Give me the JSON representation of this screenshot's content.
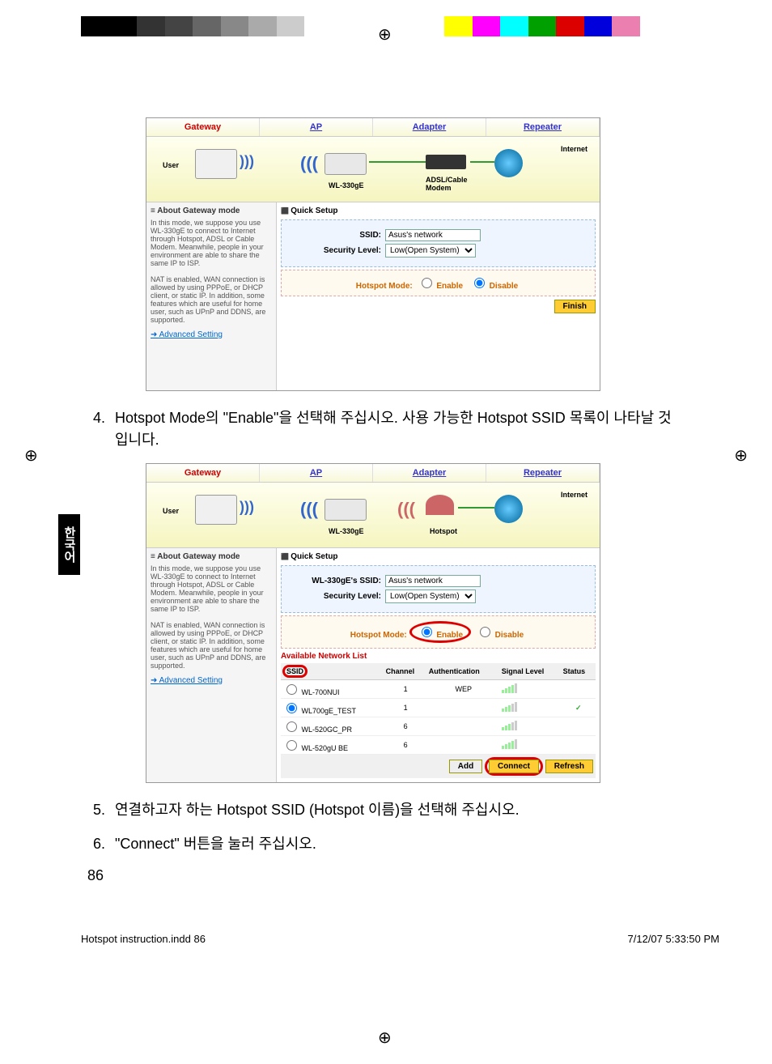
{
  "calibration_colors": [
    "#000",
    "#000",
    "#333",
    "#444",
    "#666",
    "#888",
    "#aaa",
    "#ccc",
    "#fff",
    "#fff",
    "#fff",
    "#fff",
    "#fff",
    "#ff0",
    "#f0f",
    "#0ff",
    "#00a000",
    "#d00",
    "#00d",
    "#ea7fb0",
    "#fff",
    "#fff"
  ],
  "tabs": {
    "gateway": "Gateway",
    "ap": "AP",
    "adapter": "Adapter",
    "repeater": "Repeater"
  },
  "diagram": {
    "user": "User",
    "device": "WL-330gE",
    "modem": "ADSL/Cable\nModem",
    "hotspot": "Hotspot",
    "internet": "Internet"
  },
  "about": {
    "title": "About Gateway mode",
    "p1": "In this mode, we suppose you use WL-330gE to connect to Internet through Hotspot, ADSL or Cable Modem. Meanwhile, people in your environment are able to share the same IP to ISP.",
    "p2": "NAT is enabled, WAN connection is allowed by using PPPoE, or DHCP client, or static IP. In addition, some features which are useful for home user, such as UPnP and DDNS, are supported.",
    "link": "Advanced Setting"
  },
  "setup": {
    "title": "Quick Setup",
    "ssid_label": "SSID:",
    "ssid2_label": "WL-330gE's SSID:",
    "ssid_value": "Asus's network",
    "sec_label": "Security Level:",
    "sec_value": "Low(Open System)",
    "hotspot_label": "Hotspot Mode:",
    "enable": "Enable",
    "disable": "Disable",
    "finish": "Finish"
  },
  "netlist": {
    "title": "Available Network List",
    "headers": {
      "ssid": "SSID",
      "channel": "Channel",
      "auth": "Authentication",
      "signal": "Signal Level",
      "status": "Status"
    },
    "rows": [
      {
        "ssid": "WL-700NUI",
        "channel": "1",
        "auth": "WEP",
        "sig": "s4",
        "status": ""
      },
      {
        "ssid": "WL700gE_TEST",
        "channel": "1",
        "auth": "",
        "sig": "s3",
        "status": "✓"
      },
      {
        "ssid": "WL-520GC_PR",
        "channel": "6",
        "auth": "",
        "sig": "s3",
        "status": ""
      },
      {
        "ssid": "WL-520gU BE",
        "channel": "6",
        "auth": "",
        "sig": "s4",
        "status": ""
      }
    ],
    "add": "Add",
    "connect": "Connect",
    "refresh": "Refresh"
  },
  "steps": {
    "s4": "Hotspot Mode의 \"Enable\"을 선택해 주십시오. 사용 가능한 Hotspot SSID 목록이 나타날 것입니다.",
    "s5": "연결하고자 하는 Hotspot SSID (Hotspot 이름)을 선택해 주십시오.",
    "s6": "\"Connect\" 버튼을 눌러 주십시오."
  },
  "sidebar": "한국어",
  "page_number": "86",
  "footer": {
    "left": "Hotspot instruction.indd   86",
    "right": "7/12/07   5:33:50 PM"
  }
}
